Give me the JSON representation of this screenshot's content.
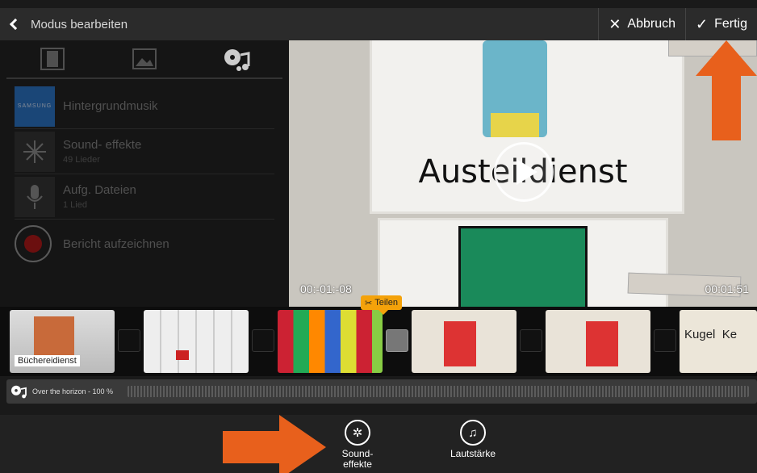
{
  "topbar": {
    "back_label": "Modus bearbeiten",
    "cancel_label": "Abbruch",
    "done_label": "Fertig"
  },
  "panel": {
    "tabs": [
      "video-tab",
      "image-tab",
      "music-tab"
    ],
    "items": [
      {
        "title": "Hintergrundmusik",
        "subtitle": "",
        "thumb": "SAMSUNG"
      },
      {
        "title": "Sound- effekte",
        "subtitle": "49 Lieder"
      },
      {
        "title": "Aufg. Dateien",
        "subtitle": "1 Lied"
      },
      {
        "title": "Bericht aufzeichnen"
      }
    ]
  },
  "video": {
    "title_text": "Austeildienst",
    "time_start": "00:-01:-08",
    "time_end": "00:01:51"
  },
  "timeline": {
    "split_label": "Teilen",
    "clip1_label": "Büchereidienst",
    "clip6_label": "Kugel  Ke"
  },
  "audio": {
    "label": "Over the horizon - 100 %"
  },
  "bottom": {
    "sound_label": "Sound-\neffekte",
    "volume_label": "Lautstärke"
  },
  "colors": {
    "accent": "#f4a20a",
    "arrow": "#e8601c"
  }
}
